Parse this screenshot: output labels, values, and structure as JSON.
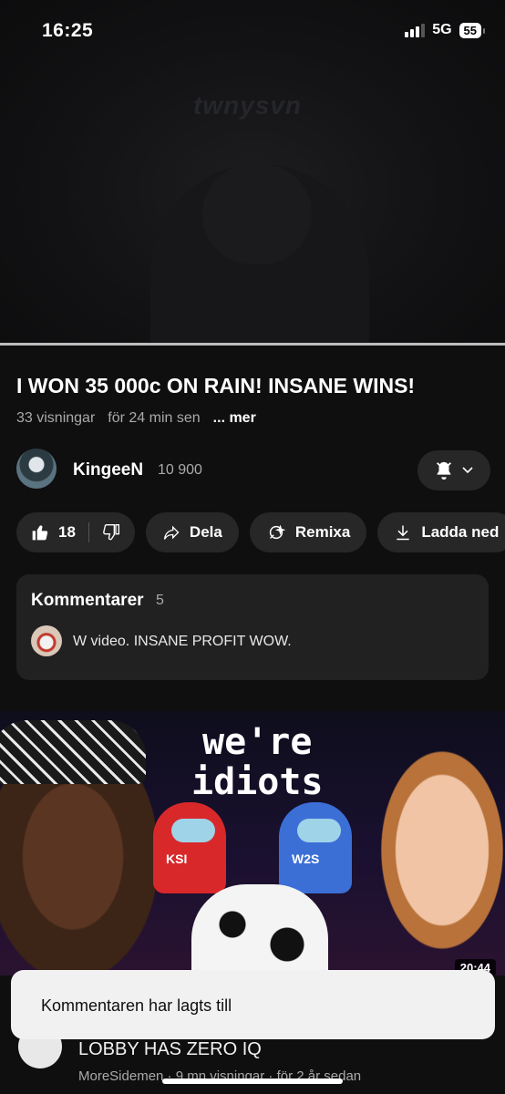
{
  "status": {
    "time": "16:25",
    "network": "5G",
    "battery": "55"
  },
  "player": {
    "watermark": "twnysvn",
    "progress_fraction": 0.0
  },
  "video": {
    "title": "I WON 35 000c ON RAIN! INSANE WINS!",
    "views": "33 visningar",
    "age": "för 24 min sen",
    "more": "... mer"
  },
  "channel": {
    "name": "KingeeN",
    "subscribers": "10 900"
  },
  "actions": {
    "likes": "18",
    "share": "Dela",
    "remix": "Remixa",
    "download": "Ladda ned"
  },
  "comments": {
    "title": "Kommentarer",
    "count": "5",
    "top_comment": "W video. INSANE PROFIT WOW."
  },
  "recommended": {
    "thumbnail_text_line1": "we're",
    "thumbnail_text_line2": "idiots",
    "crew_red_label": "KSI",
    "crew_blue_label": "W2S",
    "duration": "20:44",
    "title": "LOBBY HAS ZERO IQ",
    "meta": "MoreSidemen · 9 mn visningar · för 2 år sedan"
  },
  "toast": {
    "message": "Kommentaren har lagts till"
  }
}
